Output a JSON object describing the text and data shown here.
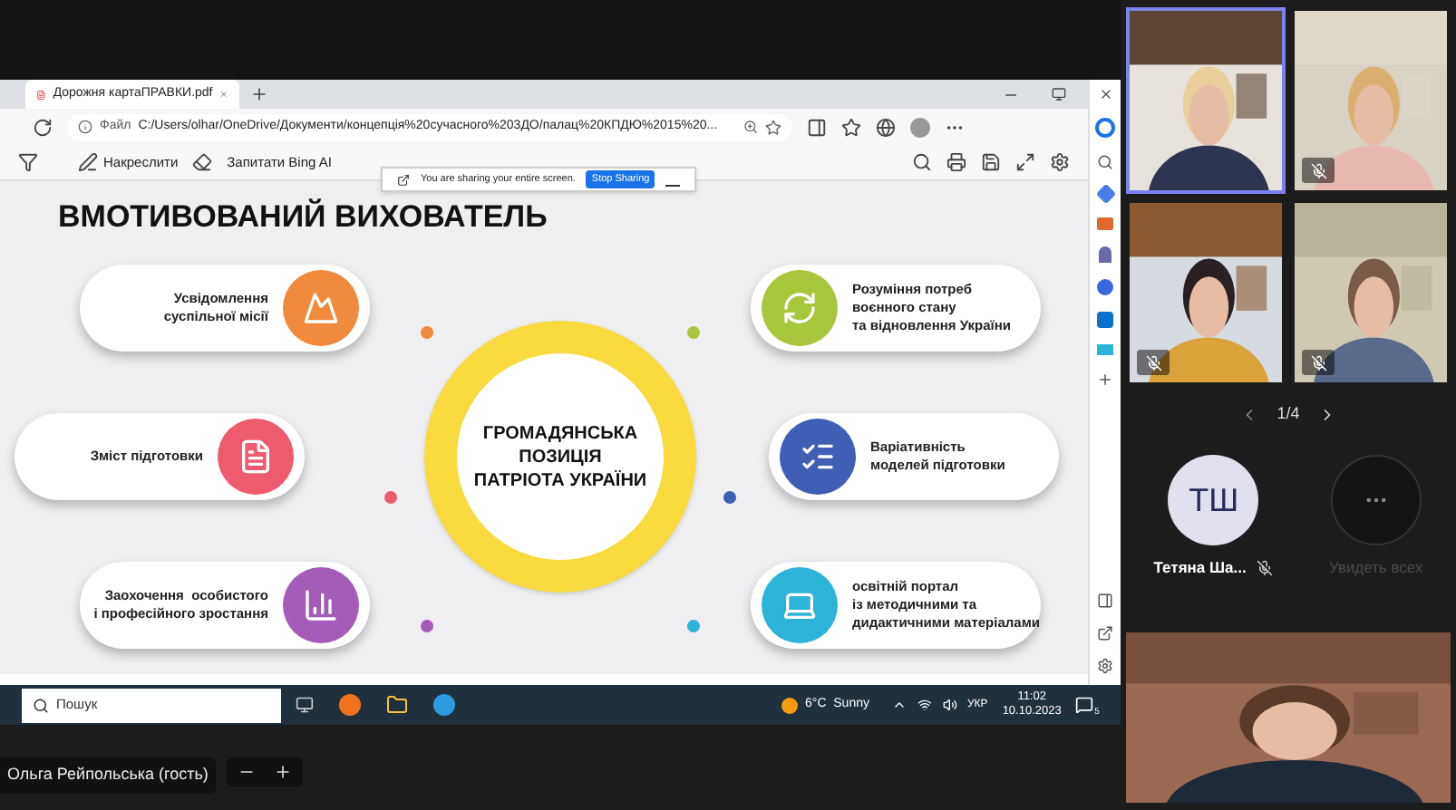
{
  "browser": {
    "tab_title": "Дорожня картаПРАВКИ.pdf",
    "address_label": "Файл",
    "url": "C:/Users/olhar/OneDrive/Документи/концепція%20сучасного%203ДО/палац%20КПДЮ%2015%20...",
    "toolbar": {
      "draw": "Накреслити",
      "ask": "Запитати Bing AI"
    }
  },
  "sharing_bar": {
    "message": "You are sharing your entire screen.",
    "stop": "Stop Sharing"
  },
  "slide": {
    "title": "ВМОТИВОВАНИЙ ВИХОВАТЕЛЬ",
    "center": "ГРОМАДЯНСЬКА ПОЗИЦІЯ ПАТРІОТА УКРАЇНИ",
    "left_items": [
      {
        "text": "Усвідомлення\nсуспільної місії",
        "color": "#f08a3c",
        "kind": "mountain"
      },
      {
        "text": "Зміст підготовки",
        "color": "#ef5b6e",
        "kind": "document"
      },
      {
        "text": "Заохочення  особистого\nі професійного зростання",
        "color": "#a45cb8",
        "kind": "chart"
      }
    ],
    "right_items": [
      {
        "text": "Розуміння потреб\nвоєнного стану\nта відновлення України",
        "color": "#a8c63c",
        "kind": "cycle"
      },
      {
        "text": "Варіативність\nмоделей підготовки",
        "color": "#3f5fb5",
        "kind": "list"
      },
      {
        "text": "освітній портал\nіз методичними та\nдидактичними матеріалами",
        "color": "#2bb3d8",
        "kind": "laptop"
      }
    ]
  },
  "taskbar": {
    "search_placeholder": "Пошук",
    "weather": "6°C  Sunny",
    "language": "УКР",
    "time": "11:02",
    "date": "10.10.2023",
    "notifications": "5"
  },
  "call": {
    "tiles": [
      {
        "muted": false,
        "selected": true
      },
      {
        "muted": true,
        "selected": false
      },
      {
        "muted": true,
        "selected": false
      },
      {
        "muted": true,
        "selected": false
      }
    ],
    "pager": "1/4",
    "participant": {
      "initials": "ТШ",
      "name": "Тетяна Ша...",
      "muted": true
    },
    "see_all": {
      "label": "Увидеть всех",
      "disabled": true
    },
    "self_name": "Ольга Рейпольська (гость)"
  }
}
